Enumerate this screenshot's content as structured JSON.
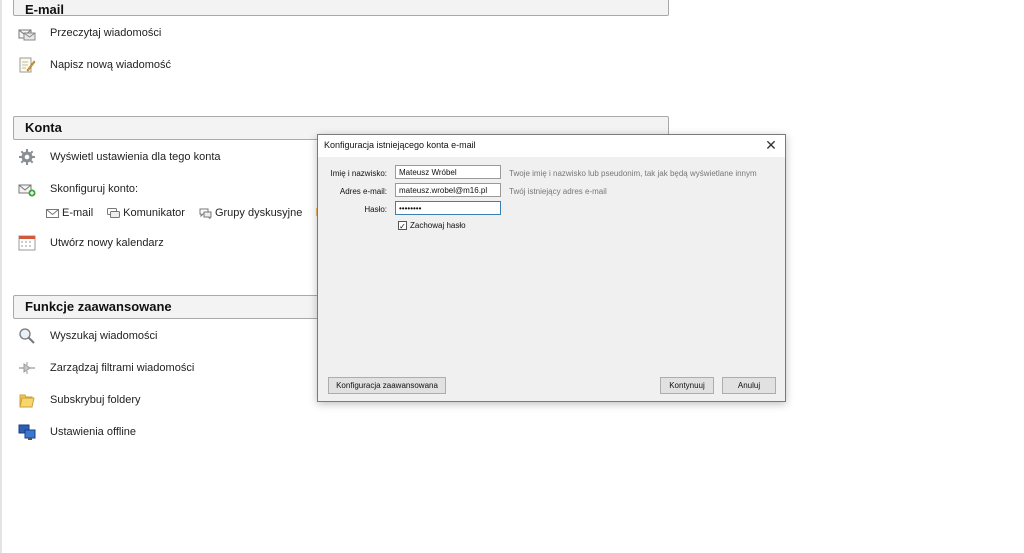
{
  "sections": {
    "email": {
      "title": "E-mail",
      "items": [
        {
          "label": "Przeczytaj wiadomości",
          "icon": "read-mail-icon"
        },
        {
          "label": "Napisz nową wiadomość",
          "icon": "compose-icon"
        }
      ]
    },
    "accounts": {
      "title": "Konta",
      "items": [
        {
          "label": "Wyświetl ustawienia dla tego konta",
          "icon": "gear-icon"
        },
        {
          "label": "Skonfiguruj konto:",
          "icon": "add-account-icon"
        },
        {
          "label": "Utwórz nowy kalendarz",
          "icon": "calendar-icon"
        }
      ],
      "sub_items": [
        {
          "label": "E-mail",
          "icon": "envelope-icon"
        },
        {
          "label": "Komunikator",
          "icon": "chat-icon"
        },
        {
          "label": "Grupy dyskusyjne",
          "icon": "newsgroup-icon"
        }
      ]
    },
    "advanced": {
      "title": "Funkcje zaawansowane",
      "items": [
        {
          "label": "Wyszukaj wiadomości",
          "icon": "search-icon"
        },
        {
          "label": "Zarządzaj filtrami wiadomości",
          "icon": "filter-icon"
        },
        {
          "label": "Subskrybuj foldery",
          "icon": "folder-icon"
        },
        {
          "label": "Ustawienia offline",
          "icon": "offline-icon"
        }
      ]
    }
  },
  "dialog": {
    "title": "Konfiguracja istniejącego konta e-mail",
    "close": "✕",
    "fields": {
      "name": {
        "label": "Imię i nazwisko:",
        "value": "Mateusz Wróbel",
        "hint": "Twoje imię i nazwisko lub pseudonim, tak jak będą wyświetlane innym"
      },
      "email": {
        "label": "Adres e-mail:",
        "value": "mateusz.wrobel@m16.pl",
        "hint": "Twój istniejący adres e-mail"
      },
      "password": {
        "label": "Hasło:",
        "value": "••••••••"
      }
    },
    "remember_password": {
      "label": "Zachowaj hasło",
      "checked": true,
      "mark": "✓"
    },
    "buttons": {
      "advanced": "Konfiguracja zaawansowana",
      "continue": "Kontynuuj",
      "cancel": "Anuluj"
    }
  }
}
